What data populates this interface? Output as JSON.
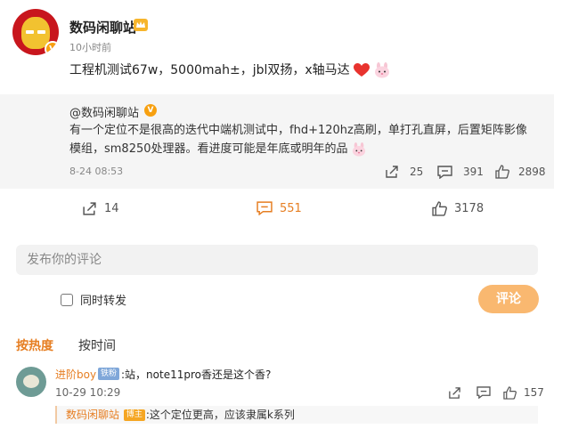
{
  "post": {
    "author": "数码闲聊站",
    "time": "10小时前",
    "text": "工程机测试67w，5000mah±，jbl双扬，x轴马达",
    "emojis": [
      "heart-emoji",
      "bunny-emoji"
    ]
  },
  "repost": {
    "author": "@数码闲聊站",
    "verified_badge": "V",
    "text": "有一个定位不是很高的迭代中端机测试中，fhd+120hz高刷，单打孔直屏，后置矩阵影像模组，sm8250处理器。看进度可能是年底或明年的品",
    "date": "8-24 08:53",
    "reposts": "25",
    "comments": "391",
    "likes": "2898"
  },
  "actions": {
    "reposts": "14",
    "comments": "551",
    "likes": "3178"
  },
  "composer": {
    "placeholder": "发布你的评论",
    "checkbox_label": "同时转发",
    "submit_label": "评论"
  },
  "sort": {
    "hot": "按热度",
    "time": "按时间"
  },
  "comment": {
    "author": "进阶boy",
    "badge": "铁粉",
    "text": ":站，note11pro香还是这个香?",
    "date": "10-29 10:29",
    "likes": "157"
  },
  "reply": {
    "author": "数码闲聊站",
    "badge": "博主",
    "text": ":这个定位更高，应该隶属k系列"
  },
  "colors": {
    "accent": "#e67e22",
    "submit_disabled": "#f9b870",
    "repost_bg": "#f5f5f5",
    "verified": "#f7a00f"
  }
}
